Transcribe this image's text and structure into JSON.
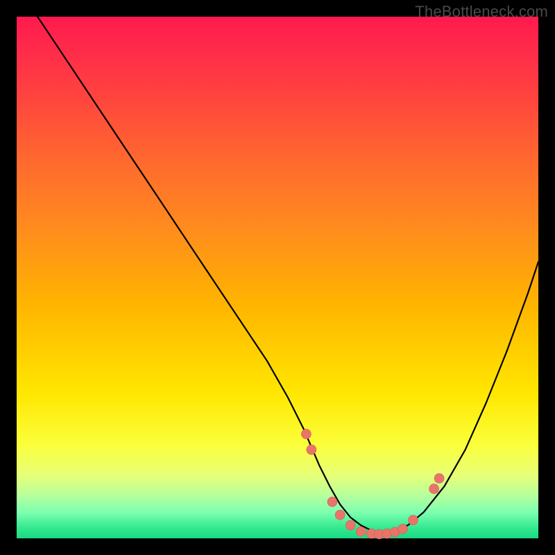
{
  "watermark": "TheBottleneck.com",
  "colors": {
    "dot_fill": "#e8756b",
    "dot_stroke": "#d2594f",
    "curve": "#000000"
  },
  "chart_data": {
    "type": "line",
    "title": "",
    "xlabel": "",
    "ylabel": "",
    "xlim": [
      0,
      100
    ],
    "ylim": [
      0,
      100
    ],
    "series": [
      {
        "name": "bottleneck-curve",
        "x": [
          4,
          8,
          12,
          16,
          20,
          24,
          28,
          32,
          36,
          40,
          44,
          48,
          52,
          55,
          58,
          60,
          62,
          64,
          66,
          68,
          70,
          72,
          75,
          78,
          82,
          86,
          90,
          94,
          98,
          100
        ],
        "y": [
          100,
          94,
          88,
          82,
          76,
          70,
          64,
          58,
          52,
          46,
          40,
          34,
          27,
          21,
          14,
          10,
          6.5,
          4,
          2.5,
          1.5,
          1,
          1.5,
          2.5,
          5,
          10,
          17,
          26,
          36,
          47,
          53
        ]
      }
    ],
    "annotations": {
      "dots": [
        {
          "x": 55.5,
          "y": 20
        },
        {
          "x": 56.5,
          "y": 17
        },
        {
          "x": 60.5,
          "y": 7
        },
        {
          "x": 62.0,
          "y": 4.5
        },
        {
          "x": 64.0,
          "y": 2.5
        },
        {
          "x": 66.0,
          "y": 1.3
        },
        {
          "x": 68.0,
          "y": 0.9
        },
        {
          "x": 69.5,
          "y": 0.8
        },
        {
          "x": 71.0,
          "y": 0.9
        },
        {
          "x": 72.5,
          "y": 1.2
        },
        {
          "x": 74.0,
          "y": 1.8
        },
        {
          "x": 76.0,
          "y": 3.5
        },
        {
          "x": 80.0,
          "y": 9.5
        },
        {
          "x": 81.0,
          "y": 11.5
        }
      ]
    }
  }
}
